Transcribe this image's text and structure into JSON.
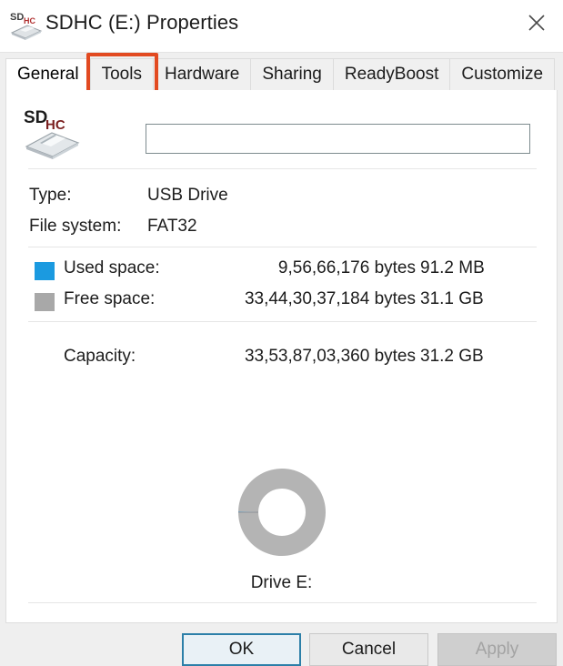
{
  "window": {
    "title": "SDHC (E:) Properties",
    "icon": "sd-card-reader-icon",
    "close_label": "✕"
  },
  "tabs": {
    "items": [
      {
        "label": "General",
        "active": true
      },
      {
        "label": "Tools",
        "active": false
      },
      {
        "label": "Hardware",
        "active": false
      },
      {
        "label": "Sharing",
        "active": false
      },
      {
        "label": "ReadyBoost",
        "active": false
      },
      {
        "label": "Customize",
        "active": false
      }
    ],
    "highlight": {
      "target": "Tools",
      "color": "#e24a21"
    }
  },
  "general": {
    "volume_label_value": "",
    "volume_label_placeholder": "",
    "drive_icon": "sdhc-card-reader-icon",
    "icon_text_top": "SD",
    "icon_text_bottom": "HC",
    "rows": [
      {
        "key": "Type:",
        "value": "USB Drive"
      },
      {
        "key": "File system:",
        "value": "FAT32"
      }
    ],
    "usage": [
      {
        "swatch": "used-space-swatch",
        "color": "#1b9ae0",
        "key": "Used space:",
        "bytes": "9,56,66,176 bytes",
        "size": "91.2 MB"
      },
      {
        "swatch": "free-space-swatch",
        "color": "#a8a8a8",
        "key": "Free space:",
        "bytes": "33,44,30,37,184 bytes",
        "size": "31.1 GB"
      }
    ],
    "capacity": {
      "key": "Capacity:",
      "bytes": "33,53,87,03,360 bytes",
      "size": "31.2 GB"
    },
    "drive_caption": "Drive E:"
  },
  "chart_data": {
    "type": "pie",
    "title": "Drive E:",
    "categories": [
      "Used space",
      "Free space"
    ],
    "values": [
      91.2,
      31846.4
    ],
    "units": "MB",
    "percents": [
      0.29,
      99.71
    ],
    "colors": [
      "#1b9ae0",
      "#b4b4b4"
    ],
    "legend": "left",
    "donut": true
  },
  "footer": {
    "ok_label": "OK",
    "cancel_label": "Cancel",
    "apply_label": "Apply",
    "apply_disabled": true
  }
}
